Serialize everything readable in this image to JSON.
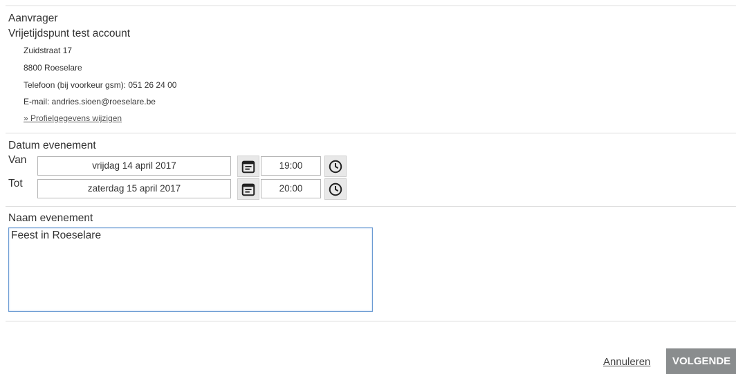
{
  "applicant": {
    "title": "Aanvrager",
    "name": "Vrijetijdspunt test account",
    "street": "Zuidstraat 17",
    "city": "8800 Roeselare",
    "phone": "Telefoon (bij voorkeur gsm): 051 26 24 00",
    "email": "E-mail: andries.sioen@roeselare.be",
    "edit_link": "» Profielgegevens wijzigen"
  },
  "event_date": {
    "title": "Datum evenement",
    "from_label": "Van",
    "from_date": "vrijdag 14 april 2017",
    "from_time": "19:00",
    "to_label": "Tot",
    "to_date": "zaterdag 15 april 2017",
    "to_time": "20:00"
  },
  "event_name": {
    "title": "Naam evenement",
    "value": "Feest in Roeselare"
  },
  "actions": {
    "cancel_label": "Annuleren",
    "next_label": "VOLGENDE"
  },
  "icons": {
    "calendar": "calendar-icon",
    "clock": "clock-icon"
  }
}
